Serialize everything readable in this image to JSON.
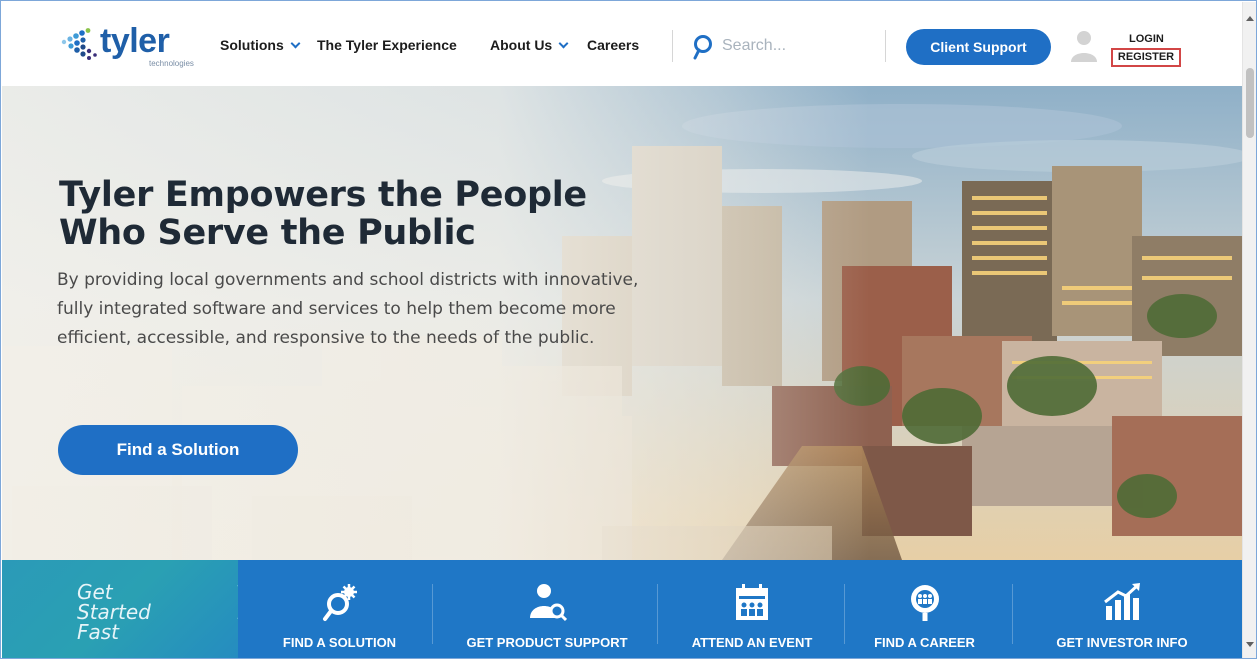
{
  "brand": {
    "name": "tyler",
    "tagline": "technologies",
    "color": "#1f5fa8"
  },
  "nav": {
    "items": [
      {
        "label": "Solutions",
        "has_dropdown": true
      },
      {
        "label": "The Tyler Experience",
        "has_dropdown": false
      },
      {
        "label": "About Us",
        "has_dropdown": true
      },
      {
        "label": "Careers",
        "has_dropdown": false
      }
    ]
  },
  "search": {
    "placeholder": "Search...",
    "value": ""
  },
  "header": {
    "client_support_label": "Client Support",
    "login_label": "LOGIN",
    "register_label": "REGISTER"
  },
  "hero": {
    "title_line1": "Tyler Empowers the People",
    "title_line2": "Who Serve the Public",
    "text": "By providing local governments and school districts with innovative, fully integrated software and services to help them become more efficient, accessible, and responsive to the needs of the public.",
    "cta_label": "Find a Solution"
  },
  "quick_links": {
    "intro_line1": "Get",
    "intro_line2": "Started",
    "intro_line3": "Fast",
    "items": [
      {
        "label": "FIND A SOLUTION",
        "icon": "gear-search-icon"
      },
      {
        "label": "GET PRODUCT SUPPORT",
        "icon": "support-person-icon"
      },
      {
        "label": "ATTEND AN EVENT",
        "icon": "calendar-people-icon"
      },
      {
        "label": "FIND A CAREER",
        "icon": "magnify-people-icon"
      },
      {
        "label": "GET INVESTOR INFO",
        "icon": "growth-chart-icon"
      }
    ]
  },
  "colors": {
    "accent": "#1f6fc5",
    "strip": "#1f77c6",
    "teal": "#2aa0b3",
    "register_highlight": "#d24646"
  }
}
